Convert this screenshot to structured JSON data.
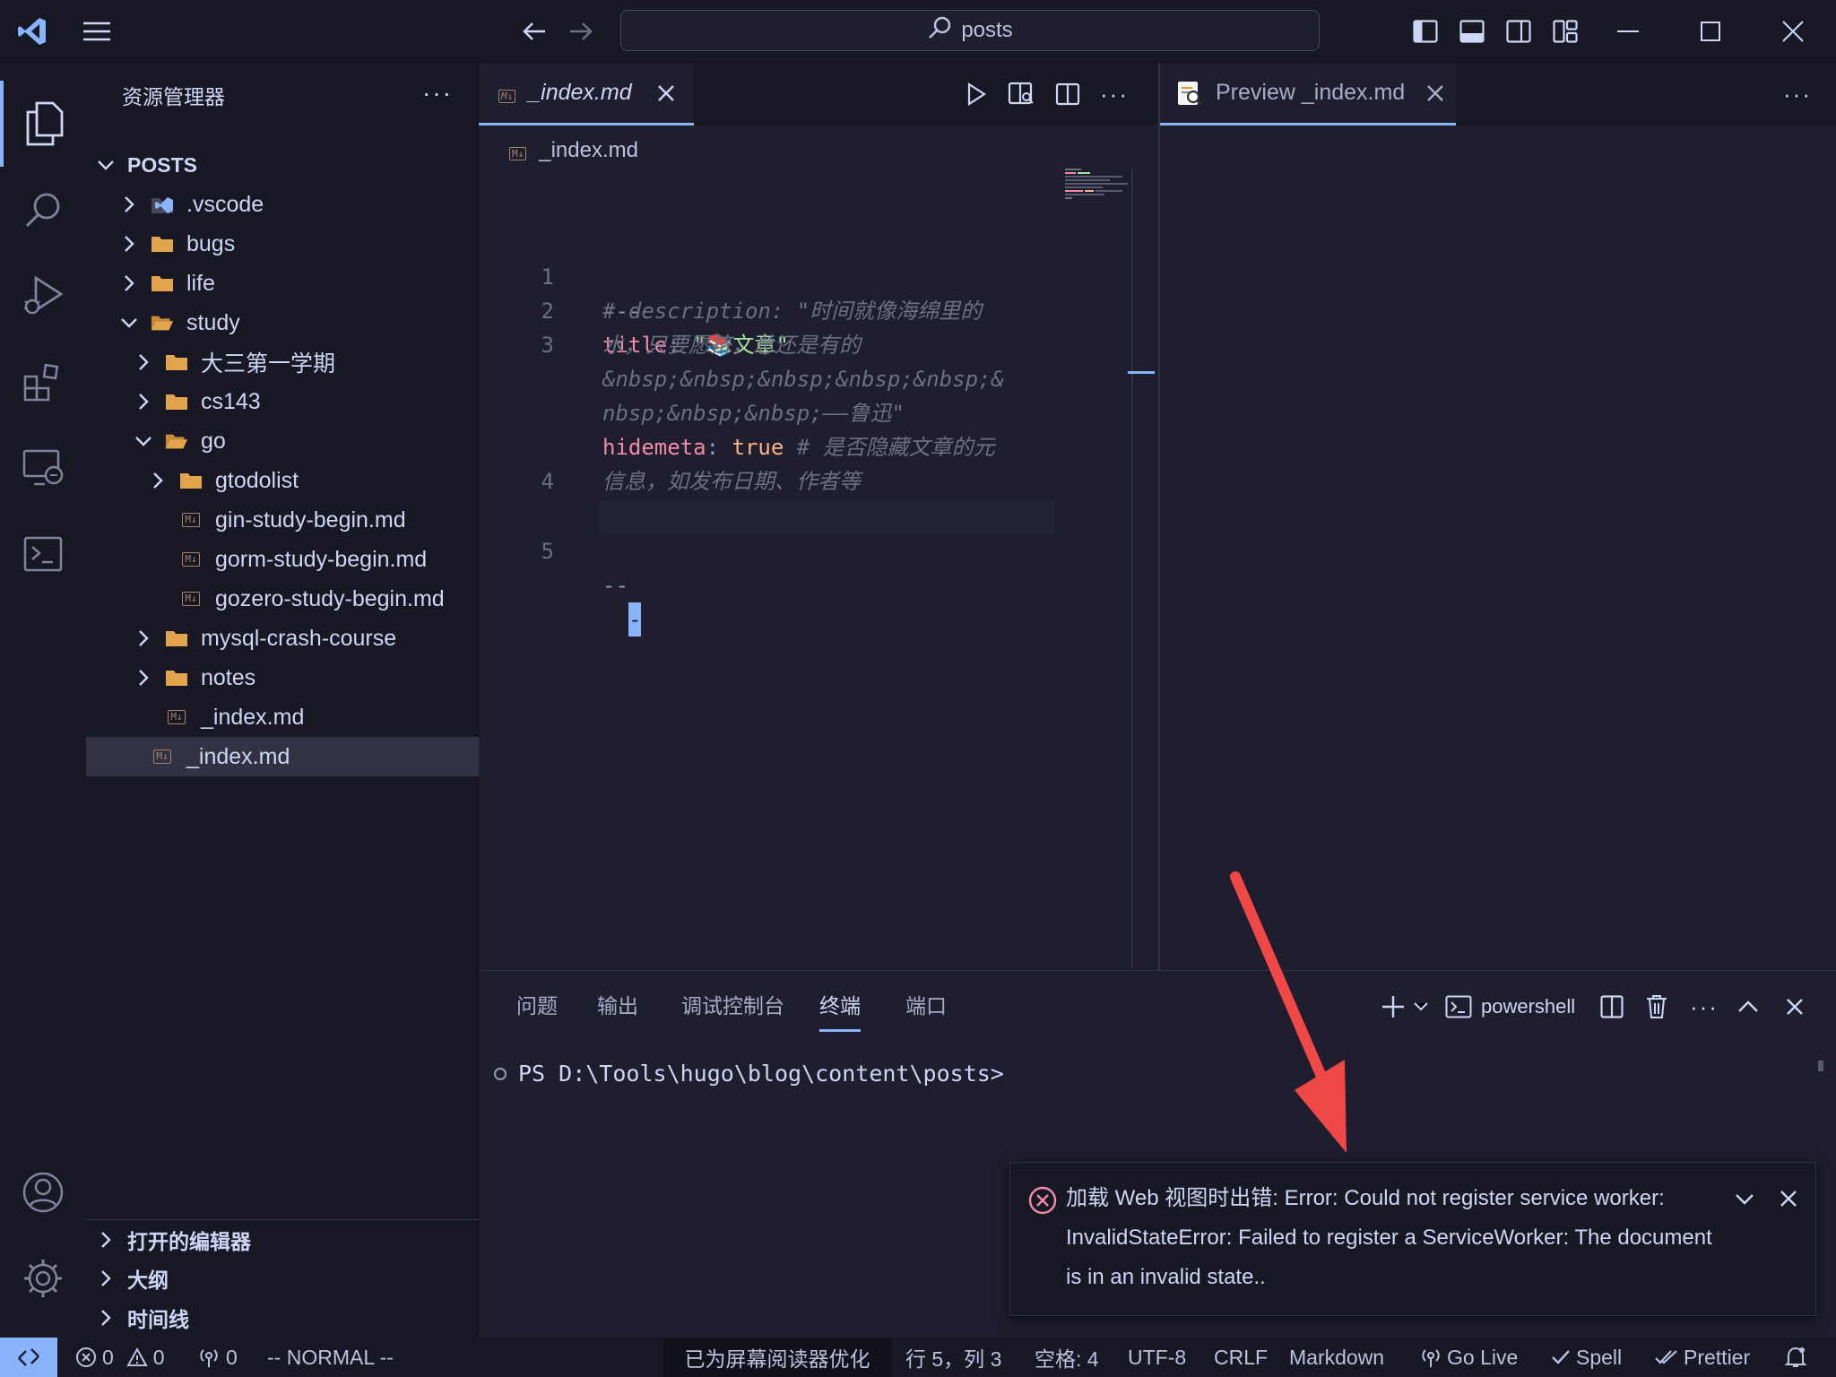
{
  "titlebar": {
    "search_text": "posts"
  },
  "sidebar": {
    "title": "资源管理器",
    "root": "POSTS",
    "items": [
      {
        "label": ".vscode"
      },
      {
        "label": "bugs"
      },
      {
        "label": "life"
      },
      {
        "label": "study"
      },
      {
        "label": "大三第一学期"
      },
      {
        "label": "cs143"
      },
      {
        "label": "go"
      },
      {
        "label": "gtodolist"
      },
      {
        "label": "gin-study-begin.md"
      },
      {
        "label": "gorm-study-begin.md"
      },
      {
        "label": "gozero-study-begin.md"
      },
      {
        "label": "mysql-crash-course"
      },
      {
        "label": "notes"
      },
      {
        "label": "_index.md"
      },
      {
        "label": "_index.md"
      }
    ],
    "sections": {
      "open_editors": "打开的编辑器",
      "outline": "大纲",
      "timeline": "时间线"
    }
  },
  "editor": {
    "tab_label": "_index.md",
    "breadcrumb": "_index.md",
    "lines": {
      "l1": {
        "num": "1",
        "text": "---"
      },
      "l2": {
        "num": "2",
        "key": "title",
        "colon": ": ",
        "q1": "\"",
        "icon": "📚",
        "value": "文章",
        "q2": "\""
      },
      "l3": {
        "num": "3",
        "a": "# description: \"时间就像海绵里的",
        "b": "水，只要愿挤，总还是有的",
        "c": "&nbsp;&nbsp;&nbsp;&nbsp;&nbsp;&",
        "d": "nbsp;&nbsp;&nbsp;——鲁迅\""
      },
      "l4": {
        "num": "4",
        "key": "hidemeta",
        "colon": ": ",
        "value": "true",
        "comment_a": " # 是否隐藏文章的元",
        "comment_b": "信息，如发布日期、作者等"
      },
      "l5": {
        "num": "5",
        "text": "--",
        "cursor": "-"
      }
    }
  },
  "preview": {
    "tab_label": "Preview _index.md"
  },
  "panel": {
    "tabs": [
      "问题",
      "输出",
      "调试控制台",
      "终端",
      "端口"
    ],
    "shell": "powershell",
    "prompt": "PS D:\\Tools\\hugo\\blog\\content\\posts>"
  },
  "notification": {
    "prefix": "加载 Web 视图时出错: ",
    "message": "Error: Could not register service worker: InvalidStateError: Failed to register a ServiceWorker: The document is in an invalid state.."
  },
  "statusbar": {
    "errors": "0",
    "warnings": "0",
    "broadcast": "0",
    "mode": "-- NORMAL --",
    "screen_reader": "已为屏幕阅读器优化",
    "position": "行 5，列 3",
    "spaces": "空格: 4",
    "encoding": "UTF-8",
    "eol": "CRLF",
    "language": "Markdown",
    "golive": "Go Live",
    "spell": "Spell",
    "prettier": "Prettier"
  },
  "colors": {
    "accent": "#89b4fa",
    "background": "#1e1e2e",
    "sidebar": "#181825",
    "error": "#f38ba8",
    "arrow": "#f04747"
  }
}
